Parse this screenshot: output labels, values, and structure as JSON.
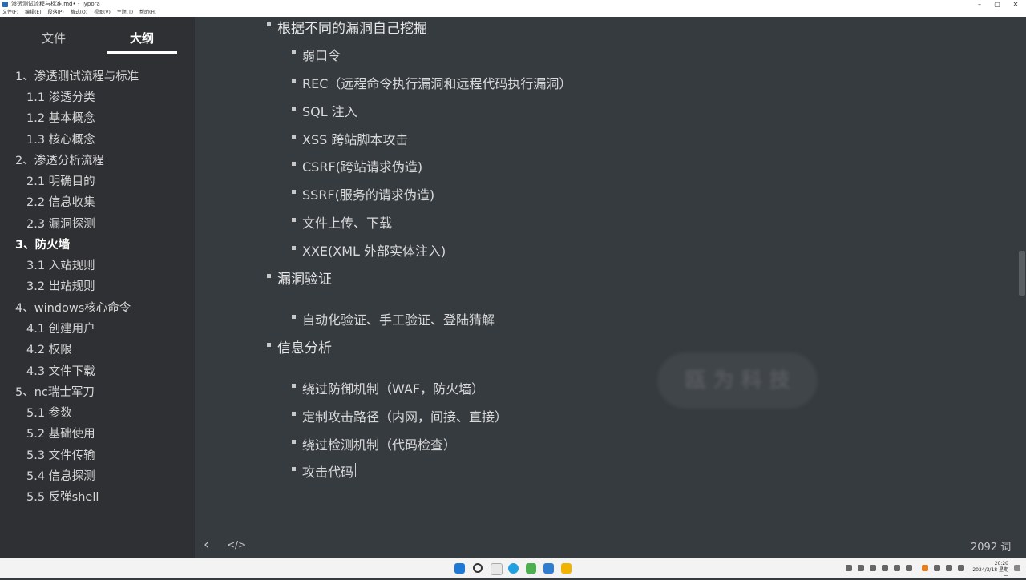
{
  "window": {
    "title": "渗透测试流程与标准.md• - Typora",
    "controls": {
      "minimize": "–",
      "maximize": "▢",
      "close": "✕"
    }
  },
  "menubar": [
    "文件(F)",
    "编辑(E)",
    "段落(P)",
    "格式(O)",
    "视图(V)",
    "主题(T)",
    "帮助(H)"
  ],
  "sidebar": {
    "tabs": [
      {
        "label": "文件",
        "active": false
      },
      {
        "label": "大纲",
        "active": true
      }
    ],
    "outline": [
      {
        "label": "1、渗透测试流程与标准",
        "level": 1,
        "active": false
      },
      {
        "label": "1.1 渗透分类",
        "level": 2,
        "active": false
      },
      {
        "label": "1.2 基本概念",
        "level": 2,
        "active": false
      },
      {
        "label": "1.3 核心概念",
        "level": 2,
        "active": false
      },
      {
        "label": "2、渗透分析流程",
        "level": 1,
        "active": false
      },
      {
        "label": "2.1 明确目的",
        "level": 2,
        "active": false
      },
      {
        "label": "2.2 信息收集",
        "level": 2,
        "active": false
      },
      {
        "label": "2.3 漏洞探测",
        "level": 2,
        "active": false
      },
      {
        "label": "3、防火墙",
        "level": 1,
        "active": true
      },
      {
        "label": "3.1 入站规则",
        "level": 2,
        "active": false
      },
      {
        "label": "3.2 出站规则",
        "level": 2,
        "active": false
      },
      {
        "label": "4、windows核心命令",
        "level": 1,
        "active": false
      },
      {
        "label": "4.1 创建用户",
        "level": 2,
        "active": false
      },
      {
        "label": "4.2 权限",
        "level": 2,
        "active": false
      },
      {
        "label": "4.3 文件下载",
        "level": 2,
        "active": false
      },
      {
        "label": "5、nc瑞士军刀",
        "level": 1,
        "active": false
      },
      {
        "label": "5.1 参数",
        "level": 2,
        "active": false
      },
      {
        "label": "5.2 基础使用",
        "level": 2,
        "active": false
      },
      {
        "label": "5.3 文件传输",
        "level": 2,
        "active": false
      },
      {
        "label": "5.4 信息探测",
        "level": 2,
        "active": false
      },
      {
        "label": "5.5 反弹shell",
        "level": 2,
        "active": false
      }
    ]
  },
  "editor": {
    "items": [
      {
        "text": "根据不同的漏洞自己挖掘",
        "level": 1
      },
      {
        "text": "弱口令",
        "level": 2
      },
      {
        "text": "REC（远程命令执行漏洞和远程代码执行漏洞）",
        "level": 2
      },
      {
        "text": "SQL 注入",
        "level": 2
      },
      {
        "text": "XSS 跨站脚本攻击",
        "level": 2
      },
      {
        "text": "CSRF(跨站请求伪造)",
        "level": 2
      },
      {
        "text": "SSRF(服务的请求伪造)",
        "level": 2
      },
      {
        "text": "文件上传、下载",
        "level": 2
      },
      {
        "text": "XXE(XML 外部实体注入)",
        "level": 2
      },
      {
        "text": "漏洞验证",
        "level": 1
      },
      {
        "text": "自动化验证、手工验证、登陆猜解",
        "level": 2
      },
      {
        "text": "信息分析",
        "level": 1
      },
      {
        "text": "绕过防御机制（WAF，防火墙）",
        "level": 2
      },
      {
        "text": "定制攻击路径（内网，间接、直接）",
        "level": 2
      },
      {
        "text": "绕过检测机制（代码检查）",
        "level": 2
      },
      {
        "text": "攻击代码",
        "level": 2
      }
    ],
    "watermark": "瓯 为 科 技"
  },
  "footer": {
    "back_icon": "‹",
    "source_icon": "</>",
    "word_count": "2092 词"
  },
  "taskbar": {
    "time": "20:20",
    "date": "2024/3/18 星期一"
  }
}
